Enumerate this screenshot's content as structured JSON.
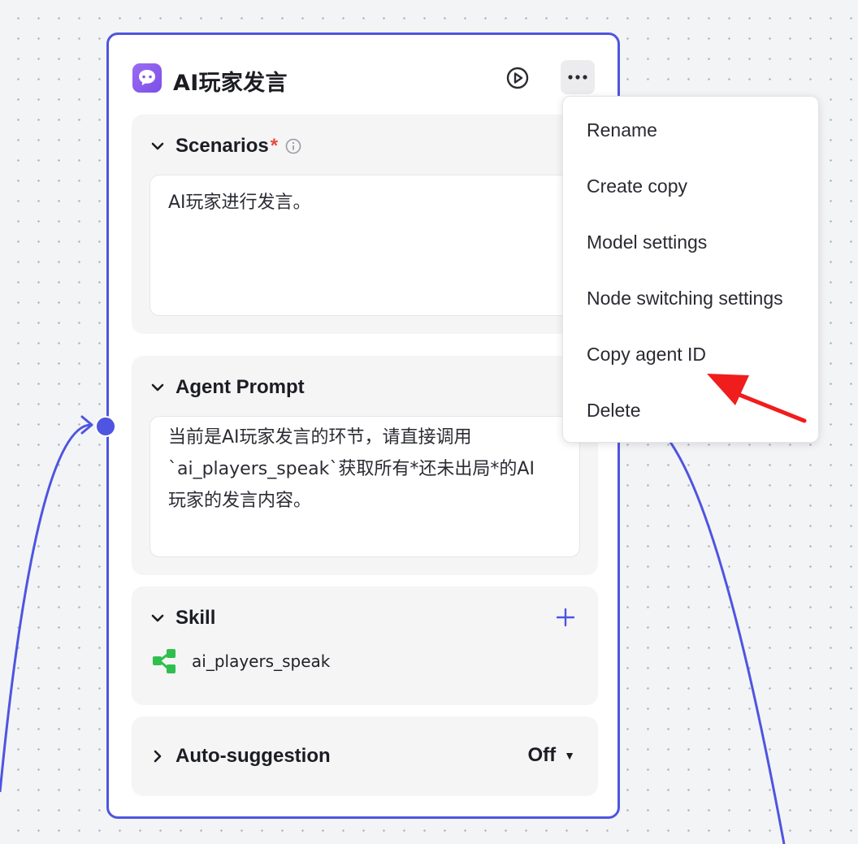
{
  "node": {
    "title": "AI玩家发言",
    "icons": {
      "node": "chat-bubble-icon",
      "run": "play-circle-icon",
      "more": "ellipsis-icon"
    }
  },
  "scenarios": {
    "title": "Scenarios",
    "required_mark": "*",
    "text": "AI玩家进行发言。"
  },
  "agent_prompt": {
    "title": "Agent Prompt",
    "lines": [
      "当前是AI玩家发言的环节，请直接调用",
      "`ai_players_speak`获取所有*还未出局*的AI",
      "玩家的发言内容。"
    ]
  },
  "skill": {
    "title": "Skill",
    "items": [
      {
        "label": "ai_players_speak",
        "icon": "workflow-icon"
      }
    ]
  },
  "auto_suggestion": {
    "title": "Auto-suggestion",
    "value": "Off"
  },
  "context_menu": {
    "items": [
      {
        "label": "Rename"
      },
      {
        "label": "Create copy"
      },
      {
        "label": "Model settings"
      },
      {
        "label": "Node switching settings"
      },
      {
        "label": "Copy agent ID"
      },
      {
        "label": "Delete"
      }
    ]
  },
  "colors": {
    "accent": "#4e55e0",
    "annotation_arrow": "#f01d1d",
    "skill_icon": "#2fbf4f"
  }
}
